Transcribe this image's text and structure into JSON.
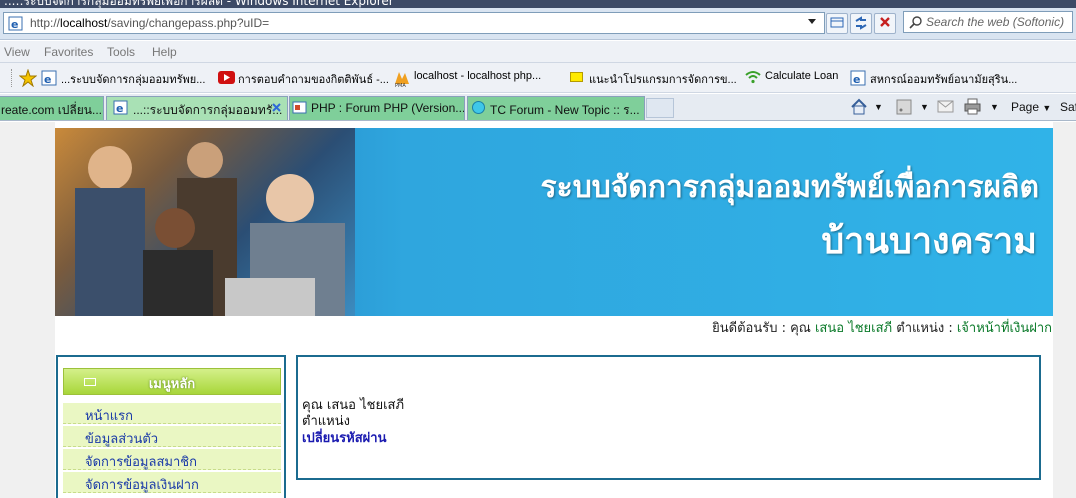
{
  "window": {
    "title": "...::ระบบจัดการกลุ่มออมทรัพย์เพื่อการผลิต - Windows Internet Explorer"
  },
  "address": {
    "url_prefix": "http://",
    "url_host": "localhost",
    "url_path": "/saving/changepass.php?uID="
  },
  "search": {
    "placeholder": "Search the web (Softonic)"
  },
  "menu": [
    "View",
    "Favorites",
    "Tools",
    "Help"
  ],
  "favorites": [
    "...ระบบจัดการกลุ่มออมทรัพย...",
    "การตอบคำถามของกิตติพันธ์ -...",
    "localhost - localhost  php...",
    "แนะนำโปรแกรมการจัดการข...",
    "Calculate Loan",
    "สหกรณ์ออมทรัพย์อนามัยสุริน..."
  ],
  "tabs": [
    "reate.com เปลี่ยน...",
    "...::ระบบจัดการกลุ่มออมทรั...",
    "PHP : Forum PHP (Version...",
    "TC Forum - New Topic :: ร..."
  ],
  "toolbar": {
    "page_label": "Page",
    "safety_label": "Saf"
  },
  "banner": {
    "title_line1": "ระบบจัดการกลุ่มออมทรัพย์เพื่อการผลิต",
    "title_line2": "บ้านบางคราม"
  },
  "welcome": {
    "prefix": "ยินดีต้อนรับ : คุณ",
    "name": "เสนอ  ไชยเสภี",
    "position_label": "ตำแหน่ง :",
    "position": "เจ้าหน้าที่เงินฝาก"
  },
  "sidebar": {
    "heading": "เมนูหลัก",
    "items": [
      {
        "label": "หน้าแรก"
      },
      {
        "label": "ข้อมูลส่วนตัว"
      },
      {
        "label": "จัดการข้อมูลสมาชิก"
      },
      {
        "label": "จัดการข้อมูลเงินฝาก"
      }
    ]
  },
  "main": {
    "line1": "คุณ เสนอ ไชยเสภี",
    "line2": "ตำแหน่ง",
    "line3": "เปลี่ยนรหัสผ่าน"
  }
}
